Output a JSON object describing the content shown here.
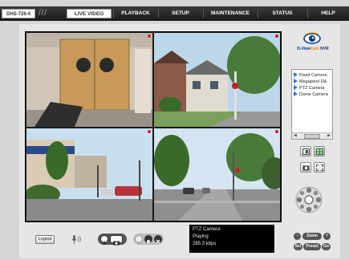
{
  "model": "DHS-726-4",
  "nav": {
    "live_video": "LIVE VIDEO",
    "playback": "PLAYBACK",
    "setup": "SETUP",
    "maintenance": "MAINTENANCE",
    "status": "STATUS",
    "help": "HELP"
  },
  "logo": {
    "part1": "D-View",
    "part2": "Cam",
    "part3": " NVR"
  },
  "camera_list": [
    "Fixed Camera",
    "Megapixel D&",
    "PTZ Camera",
    "Dome Camera"
  ],
  "zoom_label": "Zoom",
  "preset_label": "Preset",
  "preset_left": "Set",
  "preset_right": "Go",
  "logout_label": "Logout",
  "status": {
    "camera": "PTZ Camera",
    "state": "Playing",
    "bitrate": "265.3 kbps"
  },
  "colors": {
    "accent_blue": "#2a6fd6",
    "record_red": "#c81e1e",
    "nav_bg": "#222222"
  }
}
